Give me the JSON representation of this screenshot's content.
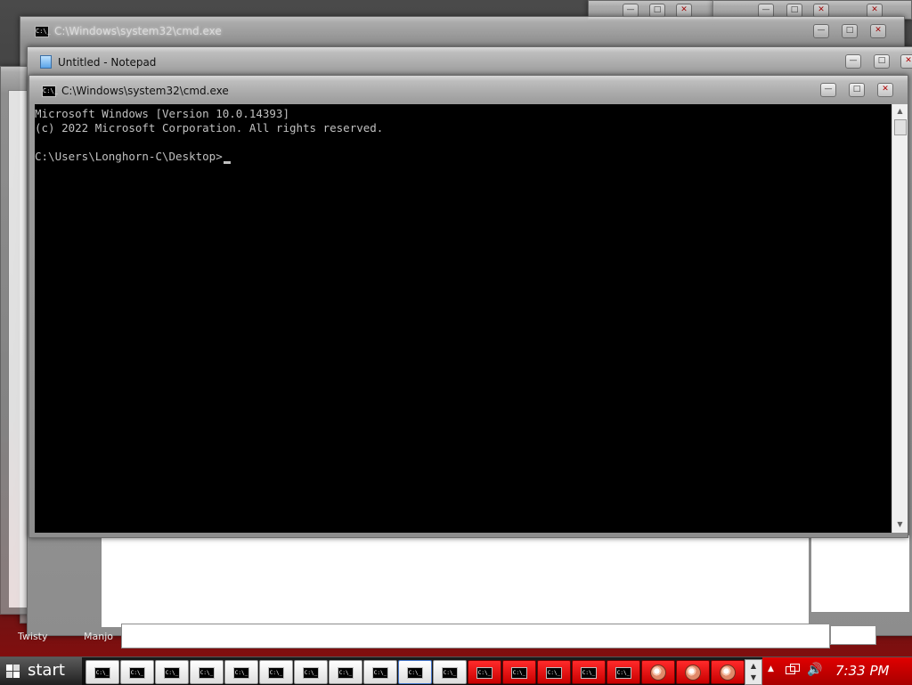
{
  "windows": {
    "bg_cmd_title": "C:\\Windows\\system32\\cmd.exe",
    "notepad_title": "Untitled - Notepad",
    "cmd_title": "C:\\Windows\\system32\\cmd.exe",
    "minimize_glyph": "—",
    "maximize_glyph": "□",
    "close_glyph": "✕"
  },
  "console": {
    "lines": [
      "Microsoft Windows [Version 10.0.14393]",
      "(c) 2022 Microsoft Corporation. All rights reserved.",
      "",
      "C:\\Users\\Longhorn-C\\Desktop>"
    ]
  },
  "scrollbar": {
    "up_arrow": "▲",
    "down_arrow": "▼"
  },
  "desktop": {
    "label_left": "Twisty",
    "label_right": "Manjo"
  },
  "taskbar": {
    "start_label": "start",
    "cmd_icon_text": "C:\\_",
    "pager_up": "▲",
    "pager_down": "▼",
    "tray_expand": "▲",
    "tray_network_icon": "network-icon",
    "tray_volume_icon": "volume-icon",
    "clock": "7:33 PM"
  },
  "colors": {
    "console_bg": "#000000",
    "console_fg": "#c0c0c0",
    "tray_red": "#d00000",
    "taskbar_red": "#e01010"
  }
}
